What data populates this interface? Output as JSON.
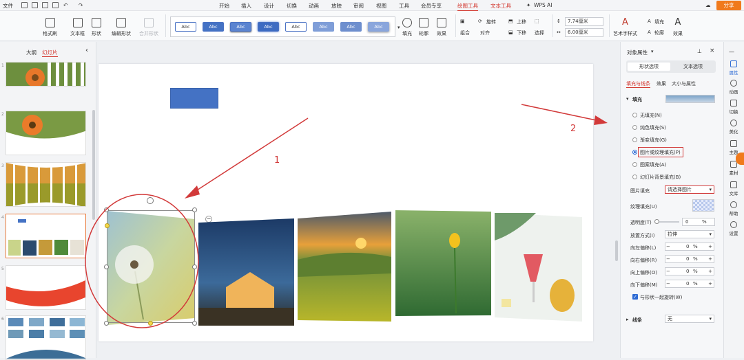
{
  "menubar": {
    "file": "文件",
    "items": [
      "开始",
      "插入",
      "设计",
      "切换",
      "动画",
      "放映",
      "审阅",
      "视图",
      "工具",
      "会员专享",
      "绘图工具",
      "文本工具",
      "WPS AI"
    ],
    "share": "分享"
  },
  "ribbon": {
    "format_painter": "格式刷",
    "textbox": "文本框",
    "shape": "形状",
    "edit_shape": "编辑形状",
    "merge_shape": "合并形状",
    "style_samples": [
      "Abc",
      "Abc",
      "Abc",
      "Abc",
      "Abc",
      "Abc",
      "Abc",
      "Abc"
    ],
    "fill": "填充",
    "outline": "轮廓",
    "effect": "效果",
    "group": "组合",
    "align": "对齐",
    "rotate": "旋转",
    "select": "选择",
    "bring_up": "上移",
    "send_down": "下移",
    "height": "7.74厘米",
    "width": "6.00厘米",
    "art_text": "艺术字样式",
    "text_fill": "填充",
    "text_outline": "轮廓",
    "text_effect": "效果"
  },
  "leftpanel": {
    "tab_outline": "大纲",
    "tab_slides": "幻灯片",
    "thumb_numbers": [
      "1",
      "2",
      "3",
      "4",
      "5",
      "6"
    ]
  },
  "annotations": {
    "one": "1",
    "two": "2"
  },
  "rightpanel": {
    "title": "对象属性",
    "tab_shape": "形状选项",
    "tab_text": "文本选项",
    "sub_fill_line": "填充与线条",
    "sub_effect": "效果",
    "sub_size": "大小与属性",
    "fill_header": "填充",
    "fill_options": [
      "无填充(N)",
      "纯色填充(S)",
      "渐变填充(G)",
      "图片或纹理填充(P)",
      "图案填充(A)",
      "幻灯片背景填充(B)"
    ],
    "picture_fill_label": "图片填充",
    "picture_fill_value": "请选择图片",
    "texture_fill_label": "纹理填充(U)",
    "transparency_label": "透明度(T)",
    "transparency_value": "0",
    "transparency_unit": "%",
    "placement_label": "放置方式(I)",
    "placement_value": "拉伸",
    "offset_left_label": "向左偏移(L)",
    "offset_right_label": "向右偏移(R)",
    "offset_up_label": "向上偏移(O)",
    "offset_down_label": "向下偏移(M)",
    "offset_value": "0",
    "offset_unit": "%",
    "rotate_with_shape": "与形状一起旋转(W)",
    "line_header": "线条",
    "line_value": "无"
  },
  "iconbar": [
    "属性",
    "动画",
    "切换",
    "美化",
    "主题",
    "素材",
    "文库",
    "帮助",
    "设置"
  ],
  "colors": {
    "accent": "#d2352c",
    "blue": "#4472c4",
    "share": "#f07a1c",
    "annotation": "#d23a3a"
  }
}
